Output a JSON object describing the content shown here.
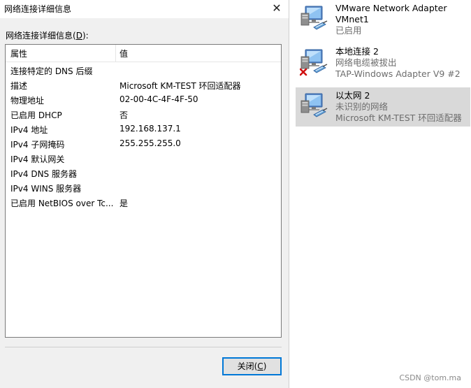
{
  "dialog": {
    "title": "网络连接详细信息",
    "list_label_prefix": "网络连接详细信息(",
    "list_label_key": "D",
    "list_label_suffix": "):",
    "columns": [
      "属性",
      "值"
    ],
    "rows": [
      {
        "property": "连接特定的 DNS 后缀",
        "value": ""
      },
      {
        "property": "描述",
        "value": "Microsoft KM-TEST 环回适配器"
      },
      {
        "property": "物理地址",
        "value": "02-00-4C-4F-4F-50"
      },
      {
        "property": "已启用 DHCP",
        "value": "否"
      },
      {
        "property": "IPv4 地址",
        "value": "192.168.137.1"
      },
      {
        "property": "IPv4 子网掩码",
        "value": "255.255.255.0"
      },
      {
        "property": "IPv4 默认网关",
        "value": ""
      },
      {
        "property": "IPv4 DNS 服务器",
        "value": ""
      },
      {
        "property": "IPv4 WINS 服务器",
        "value": ""
      },
      {
        "property": "已启用 NetBIOS over Tc...",
        "value": "是"
      }
    ],
    "close_button_prefix": "关闭(",
    "close_button_key": "C",
    "close_button_suffix": ")",
    "close_icon": "✕"
  },
  "adapters": [
    {
      "name": "VMware Network Adapter VMnet1",
      "status": "已启用",
      "device": "",
      "disconnected": false,
      "selected": false
    },
    {
      "name": "本地连接 2",
      "status": "网络电缆被拔出",
      "device": "TAP-Windows Adapter V9 #2",
      "disconnected": true,
      "selected": false
    },
    {
      "name": "以太网 2",
      "status": "未识别的网络",
      "device": "Microsoft KM-TEST 环回适配器",
      "disconnected": false,
      "selected": true
    }
  ],
  "watermark": "CSDN @tom.ma",
  "colors": {
    "accent": "#0078d7",
    "selection": "#d9d9d9",
    "error": "#d01010"
  }
}
